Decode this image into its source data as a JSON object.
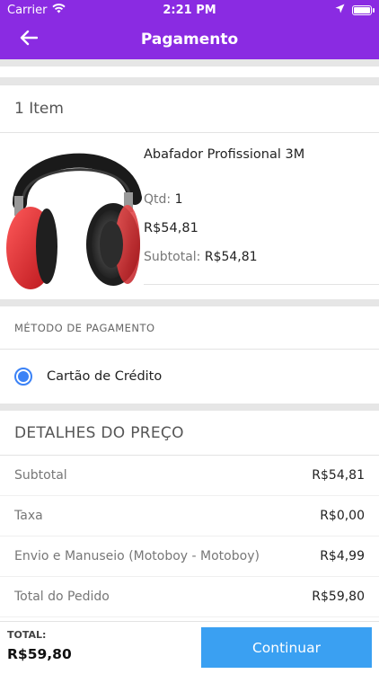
{
  "status_bar": {
    "carrier": "Carrier",
    "time": "2:21 PM",
    "battery_level": 0.9
  },
  "nav": {
    "title": "Pagamento",
    "back_icon": "arrow-left-icon"
  },
  "items_section": {
    "header": "1 Item",
    "products": [
      {
        "name": "Abafador Profissional 3M",
        "qty_label": "Qtd:",
        "qty_value": "1",
        "price": "R$54,81",
        "subtotal_label": "Subtotal:",
        "subtotal_value": "R$54,81"
      }
    ]
  },
  "payment_section": {
    "header": "MÉTODO DE PAGAMENTO",
    "option_label": "Cartão de Crédito",
    "selected": true
  },
  "price_details": {
    "header": "DETALHES DO PREÇO",
    "rows": [
      {
        "label": "Subtotal",
        "value": "R$54,81"
      },
      {
        "label": "Taxa",
        "value": "R$0,00"
      },
      {
        "label": "Envio e Manuseio (Motoboy -  Motoboy)",
        "value": "R$4,99"
      },
      {
        "label": "Total do Pedido",
        "value": "R$59,80"
      }
    ]
  },
  "bottom_bar": {
    "total_label": "TOTAL:",
    "total_value": "R$59,80",
    "continue_label": "Continuar"
  },
  "colors": {
    "brand": "#8a2be2",
    "accent": "#3aa0f2",
    "radio": "#3b82f6"
  }
}
